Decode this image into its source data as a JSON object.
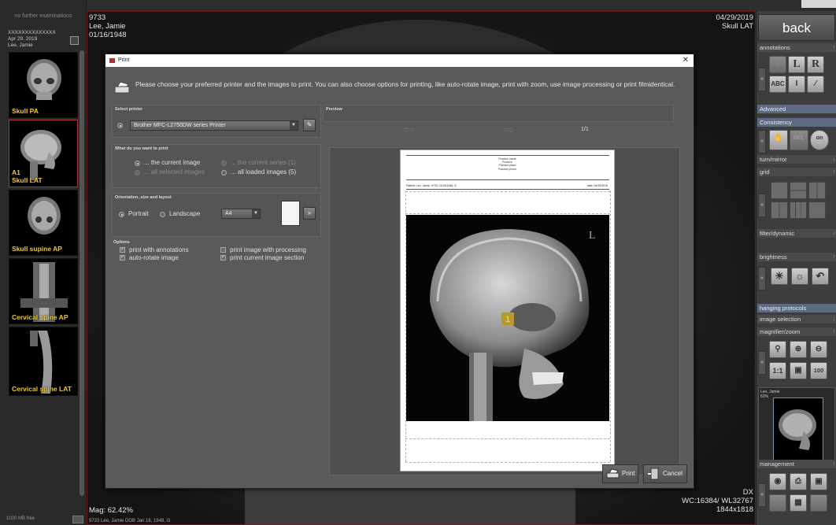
{
  "left_panel": {
    "hint": "no further examinations",
    "header_id": "XXXXXXXXXXXXXX",
    "header_date": "Apr 29, 2019",
    "header_name": "Lee, Jamie",
    "thumbnails": [
      {
        "label": "Skull PA"
      },
      {
        "label": "A1\nSkull LAT"
      },
      {
        "label": "Skull supine AP"
      },
      {
        "label": "Cervical spine AP"
      },
      {
        "label": "Cervical spine LAT"
      }
    ],
    "free_text": "1020 MB free"
  },
  "viewer": {
    "patient_id": "9733",
    "patient_name": "Lee, Jamie",
    "dob": "01/16/1948",
    "study_date": "04/29/2019",
    "series": "Skull LAT",
    "mag": "Mag: 62.42%",
    "modality": "DX",
    "window": "WC:16384/ WL32767",
    "dims": "1844x1818",
    "bottom_info": "9733 Lee, Jamie DOB Jan 16, 1948, G"
  },
  "right_panel": {
    "back": "back",
    "sections": {
      "annotations": "annotations",
      "advanced": "Advanced",
      "consistency": "Consistency",
      "turn_mirror": "turn/mirror",
      "grid": "grid",
      "filter": "filter/dynamic",
      "brightness": "brightness",
      "hanging": "hanging protocols",
      "image_selection": "image selection",
      "magnifier": "magnifier/zoom",
      "management": "management"
    },
    "buttons": {
      "L": "L",
      "R": "R",
      "abc": "ABC",
      "del": "DEL",
      "on": "on",
      "one_to_one": "1:1",
      "hundred": "100"
    },
    "mini_name": "Lee, Jamie",
    "mini_pct": "62%"
  },
  "dialog": {
    "title": "Print",
    "intro": "Please choose your preferred printer and the images to print. You can also choose options for printing, like auto-rotate image, print with zoom, use image processing or print filmidentical.",
    "select_printer": {
      "title": "Select printer",
      "printer": "Brother MFC-L2750DW series Printer"
    },
    "what": {
      "title": "What do you want to print",
      "current_image": "... the current image",
      "current_series": "... the current series (1)",
      "all_selected": "... all selected images",
      "all_loaded": "... all loaded images (5)"
    },
    "orientation": {
      "title": "Orientation, size and layout",
      "portrait": "Portrait",
      "landscape": "Landscape",
      "size": "A4"
    },
    "options": {
      "title": "Options",
      "annotations": "print with annotations",
      "processing": "print image with processing",
      "autorotate": "auto-rotate image",
      "section": "print current image section"
    },
    "preview": {
      "title": "Preview",
      "page": "1/1",
      "header_lines": [
        "Practice name",
        "Practice",
        "Practice place",
        "Practice phone"
      ],
      "patient": "Patient: Lee, Jamie, 9733, 01/16/1948, G",
      "date": "date: 04/29/2019",
      "marker": "1"
    },
    "print_btn": "Print",
    "cancel_btn": "Cancel"
  }
}
